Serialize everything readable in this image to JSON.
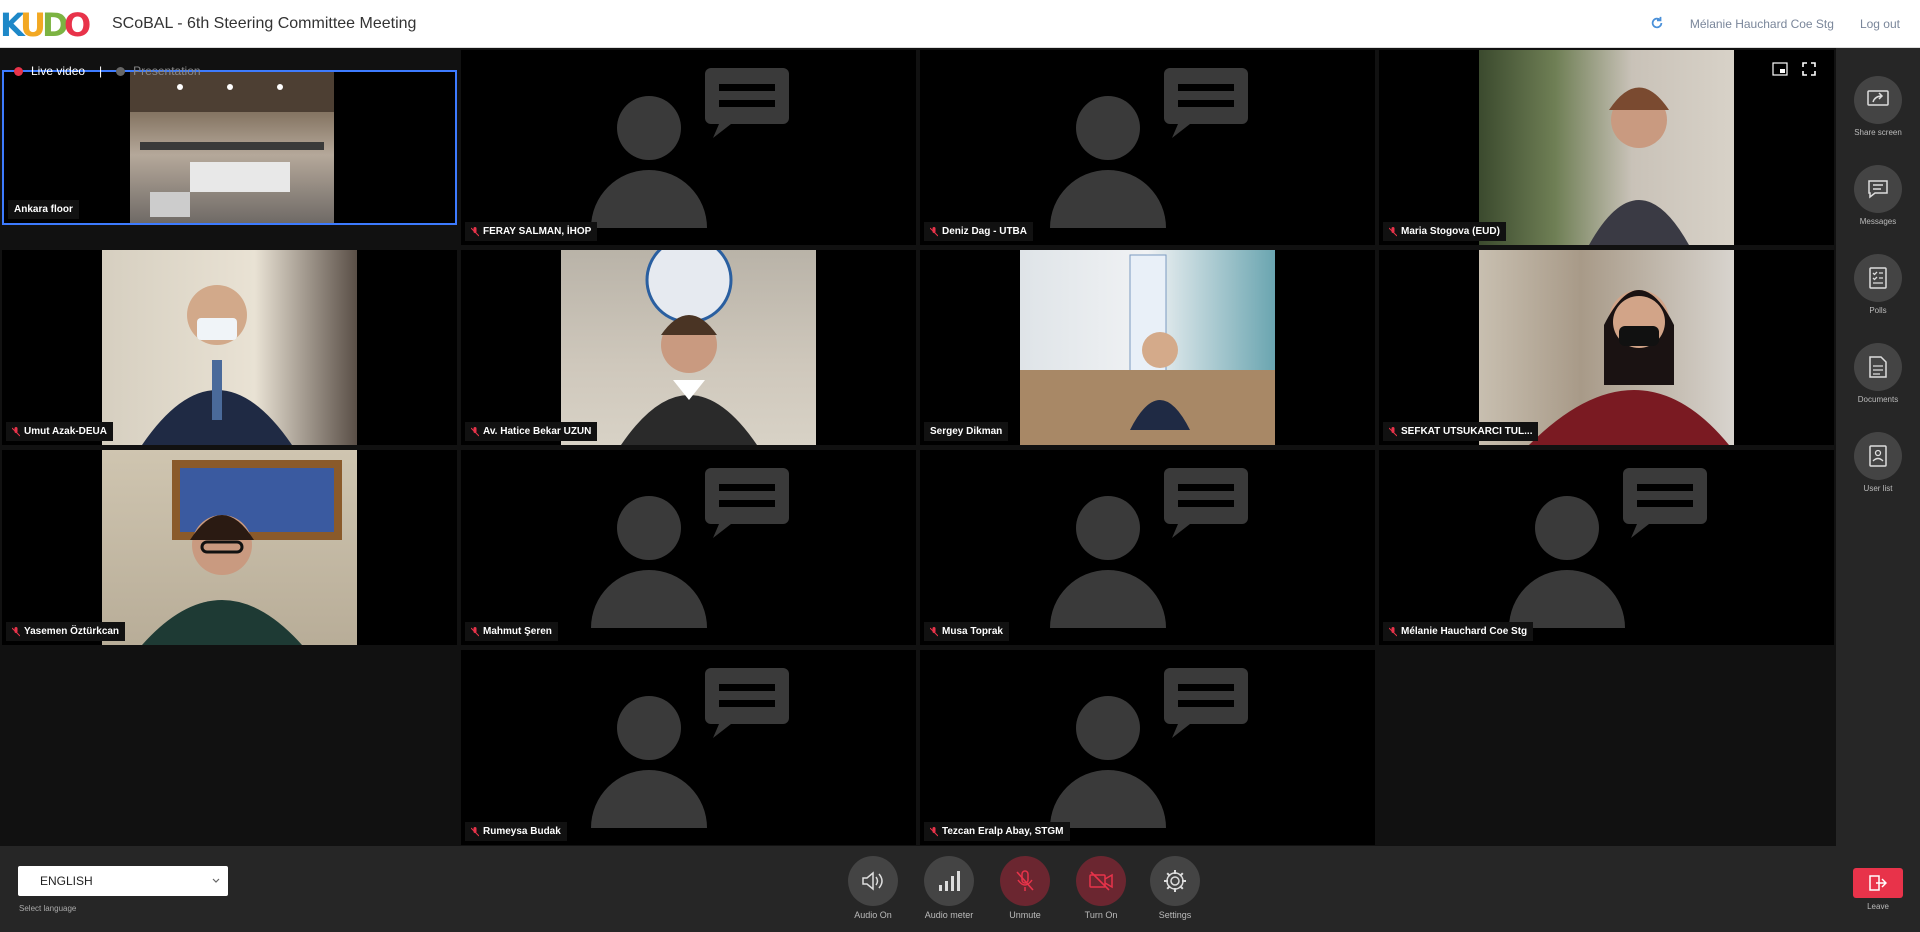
{
  "header": {
    "logo": "KUDO",
    "title": "SCoBAL - 6th Steering Committee Meeting",
    "user_name": "Mélanie Hauchard Coe Stg",
    "logout_label": "Log out"
  },
  "stage": {
    "live_label": "Live video",
    "presentation_label": "Presentation"
  },
  "participants": [
    {
      "name": "Ankara floor"
    },
    {
      "name": "FERAY SALMAN, İHOP"
    },
    {
      "name": "Deniz Dag - UTBA"
    },
    {
      "name": "Maria Stogova (EUD)"
    },
    {
      "name": "Umut Azak-DEUA"
    },
    {
      "name": "Av. Hatice Bekar UZUN"
    },
    {
      "name": "Sergey Dikman"
    },
    {
      "name": "SEFKAT UTSUKARCI TUL..."
    },
    {
      "name": "Yasemen Öztürkcan"
    },
    {
      "name": "Mahmut Şeren"
    },
    {
      "name": "Musa Toprak"
    },
    {
      "name": "Mélanie Hauchard Coe Stg"
    },
    {
      "name": "Rumeysa Budak"
    },
    {
      "name": "Tezcan Eralp Abay, STGM"
    }
  ],
  "sidebar": {
    "share_screen": "Share screen",
    "messages": "Messages",
    "polls": "Polls",
    "documents": "Documents",
    "user_list": "User list",
    "leave": "Leave"
  },
  "bottombar": {
    "language_value": "ENGLISH",
    "language_label": "Select language",
    "audio_on": "Audio On",
    "audio_meter": "Audio meter",
    "unmute": "Unmute",
    "turn_on": "Turn On",
    "settings": "Settings"
  },
  "colors": {
    "accent_red": "#e8334a",
    "selected_border": "#3d7bff",
    "sidebar_bg": "#262626"
  }
}
